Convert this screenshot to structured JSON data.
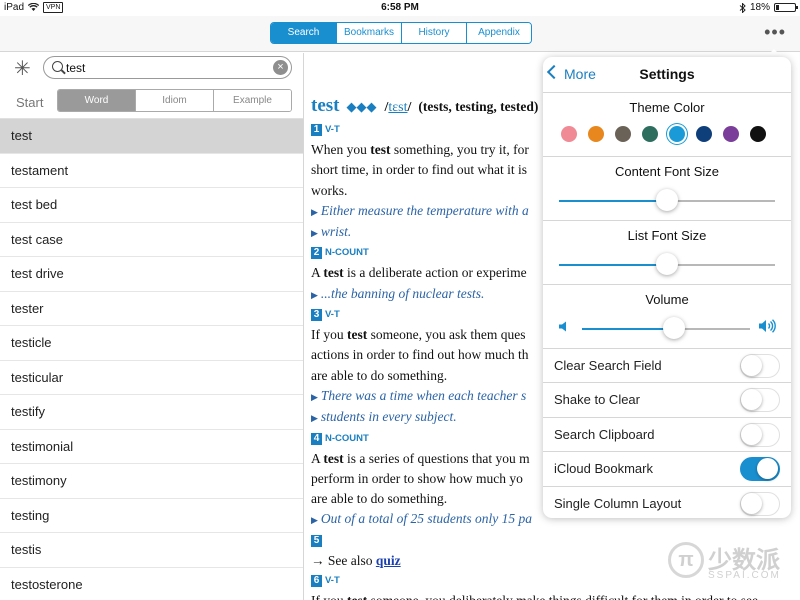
{
  "status_bar": {
    "device": "iPad",
    "vpn": "VPN",
    "time": "6:58 PM",
    "battery": "18%",
    "battery_level": 0.18
  },
  "top_nav": {
    "tabs": [
      {
        "label": "Search",
        "active": true
      },
      {
        "label": "Bookmarks",
        "active": false
      },
      {
        "label": "History",
        "active": false
      },
      {
        "label": "Appendix",
        "active": false
      }
    ],
    "more_icon": "ellipsis-icon"
  },
  "search": {
    "value": "test",
    "start_label": "Start",
    "modes": [
      {
        "label": "Word",
        "active": true
      },
      {
        "label": "Idiom",
        "active": false
      },
      {
        "label": "Example",
        "active": false
      }
    ]
  },
  "word_list": [
    "test",
    "testament",
    "test bed",
    "test case",
    "test drive",
    "tester",
    "testicle",
    "testicular",
    "testify",
    "testimonial",
    "testimony",
    "testing",
    "testis",
    "testosterone"
  ],
  "selected_word_index": 0,
  "entry": {
    "headword": "test",
    "frequency": "◆◆◆",
    "pron_prefix": "/",
    "pron": "tɛst",
    "pron_suffix": "/",
    "forms": "(tests, testing, tested)",
    "lines": [
      {
        "type": "sense",
        "num": "1",
        "label": "V-T"
      },
      {
        "type": "def",
        "text": "When you test something, you try it, for"
      },
      {
        "type": "def",
        "text": "short time, in order to find out what it is"
      },
      {
        "type": "def",
        "text": "works."
      },
      {
        "type": "example",
        "text": "Either measure the temperature with a"
      },
      {
        "type": "example",
        "text": "wrist."
      },
      {
        "type": "sense",
        "num": "2",
        "label": "N-COUNT"
      },
      {
        "type": "def",
        "text": "A test is a deliberate action or experime"
      },
      {
        "type": "example",
        "text": "...the banning of nuclear tests."
      },
      {
        "type": "sense",
        "num": "3",
        "label": "V-T"
      },
      {
        "type": "def",
        "text": "If you test someone, you ask them ques"
      },
      {
        "type": "def",
        "text": "actions in order to find out how much th"
      },
      {
        "type": "def",
        "text": "are able to do something."
      },
      {
        "type": "example",
        "text": "There was a time when each teacher s"
      },
      {
        "type": "example",
        "text": "students in every subject."
      },
      {
        "type": "sense",
        "num": "4",
        "label": "N-COUNT"
      },
      {
        "type": "def",
        "text": "A test is a series of questions that you m"
      },
      {
        "type": "def",
        "text": "perform in order to show how much yo"
      },
      {
        "type": "def",
        "text": "are able to do something."
      },
      {
        "type": "example",
        "text": "Out of a total of 25 students only 15 pa"
      },
      {
        "type": "sense",
        "num": "5",
        "label": ""
      },
      {
        "type": "seealso",
        "text": "→ See also ",
        "link": "quiz"
      },
      {
        "type": "sense",
        "num": "6",
        "label": "V-T"
      },
      {
        "type": "def",
        "text": "If you test someone, you deliberately make things difficult for them in order to see"
      }
    ]
  },
  "settings": {
    "back_label": "More",
    "title": "Settings",
    "theme_color_label": "Theme Color",
    "theme_colors": [
      "#f08a94",
      "#e8871e",
      "#6b6257",
      "#2e6e5e",
      "#1a9ad6",
      "#0f3f7a",
      "#7a3e9a",
      "#111111"
    ],
    "selected_color_index": 4,
    "content_font_label": "Content Font Size",
    "content_font_value": 0.5,
    "list_font_label": "List Font Size",
    "list_font_value": 0.5,
    "volume_label": "Volume",
    "volume_value": 0.55,
    "toggles": [
      {
        "label": "Clear Search Field",
        "on": false
      },
      {
        "label": "Shake to Clear",
        "on": false
      },
      {
        "label": "Search Clipboard",
        "on": false
      },
      {
        "label": "iCloud Bookmark",
        "on": true
      },
      {
        "label": "Single Column Layout",
        "on": false
      }
    ]
  },
  "watermark": {
    "symbol": "π",
    "text": "少数派",
    "subtext": "SSPAI.COM"
  }
}
